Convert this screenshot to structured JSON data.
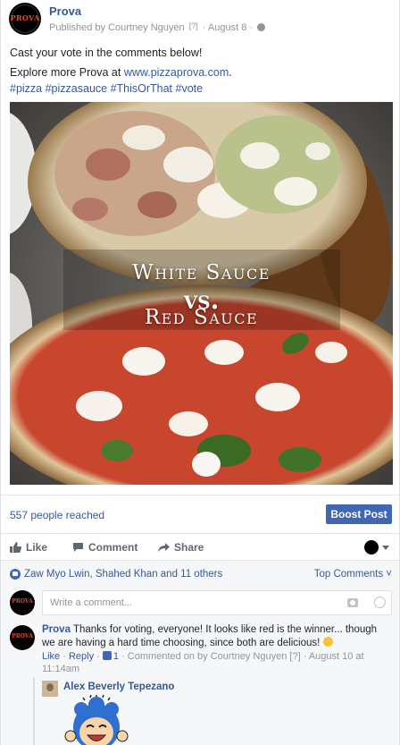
{
  "post": {
    "page_name": "Prova",
    "avatar_text": "PROVA",
    "published_by": "Published by Courtney Nguyen",
    "help_mark": "[?]",
    "date": "· August 8 ·",
    "line1": "Cast your vote in the comments below!",
    "line2_prefix": "Explore more Prova at ",
    "line2_link": "www.pizzaprova.com",
    "line2_suffix": ".",
    "hashtags": "#pizza #pizzasauce #ThisOrThat #vote",
    "image_text": {
      "top": "White Sauce",
      "mid": "vs.",
      "bottom": "Red Sauce"
    }
  },
  "reach": {
    "text": "557 people reached",
    "boost_label": "Boost Post"
  },
  "actions": {
    "like": "Like",
    "comment": "Comment",
    "share": "Share"
  },
  "comments_section": {
    "likers": "Zaw Myo Lwin, Shahed Khan and 11 others",
    "sort_label": "Top Comments",
    "input_placeholder": "Write a comment...",
    "comment": {
      "author": "Prova",
      "text": "Thanks for voting, everyone! It looks like red is the winner... though we are having a hard time choosing, since both are delicious!",
      "like": "Like",
      "reply": "Reply",
      "like_count": "1",
      "commented_on": "· Commented on by Courtney Nguyen",
      "help_mark": "[?]",
      "timestamp": "· August 10 at 11:14am"
    },
    "reply": {
      "author": "Alex Beverly Tepezano"
    }
  },
  "icons": {
    "globe": "globe-icon",
    "like": "thumbs-up-icon",
    "comment": "comment-bubble-icon",
    "share": "share-arrow-icon",
    "camera": "camera-icon",
    "emoji": "emoji-icon",
    "sticker": "laughing-boy-sticker"
  },
  "colors": {
    "link": "#365899",
    "button": "#4267b2",
    "muted": "#90949c"
  }
}
